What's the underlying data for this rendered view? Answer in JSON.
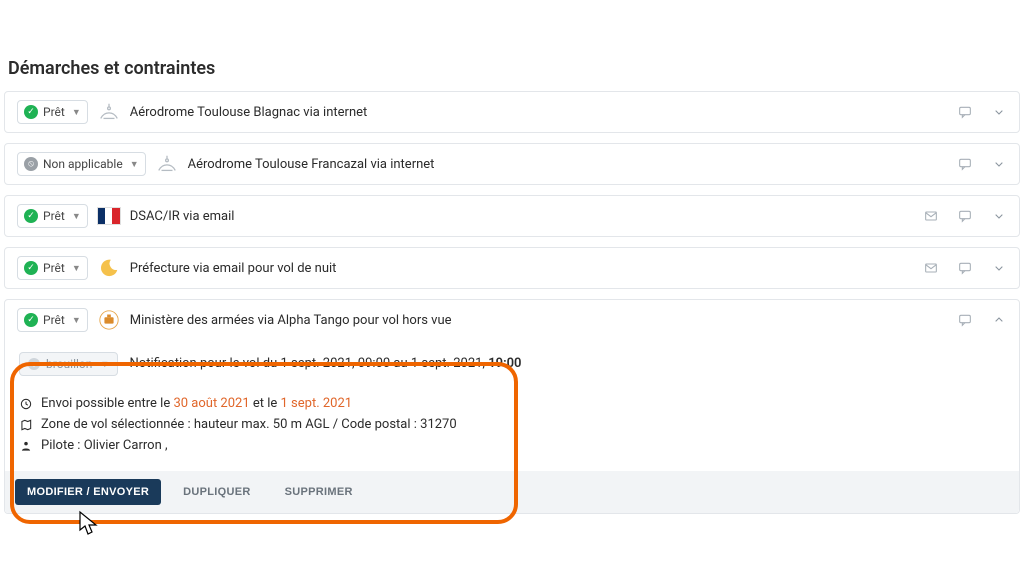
{
  "section_title": "Démarches et contraintes",
  "status": {
    "ready": "Prêt",
    "na": "Non applicable",
    "draft": "brouillon"
  },
  "rows": [
    {
      "title": "Aérodrome Toulouse Blagnac via internet"
    },
    {
      "title": "Aérodrome Toulouse Francazal via internet"
    },
    {
      "title": "DSAC/IR via email"
    },
    {
      "title": "Préfecture via email pour vol de nuit"
    },
    {
      "title": "Ministère des armées via Alpha Tango pour vol hors vue"
    }
  ],
  "notif": {
    "title_prefix": "Notification pour le vol du 1 sept. 2021, 09:00 au 1 sept. 2021, ",
    "title_bold": "19:00",
    "send_window_pre": "Envoi possible entre le ",
    "send_window_d1": "30 août 2021",
    "send_window_mid": " et le ",
    "send_window_d2": "1 sept. 2021",
    "zone": "Zone de vol sélectionnée : hauteur max. 50 m AGL / Code postal : 31270",
    "pilot_label": "Pilote : ",
    "pilot_name": "Olivier Carron ,"
  },
  "buttons": {
    "modify": "MODIFIER / ENVOYER",
    "duplicate": "DUPLIQUER",
    "delete": "SUPPRIMER"
  }
}
